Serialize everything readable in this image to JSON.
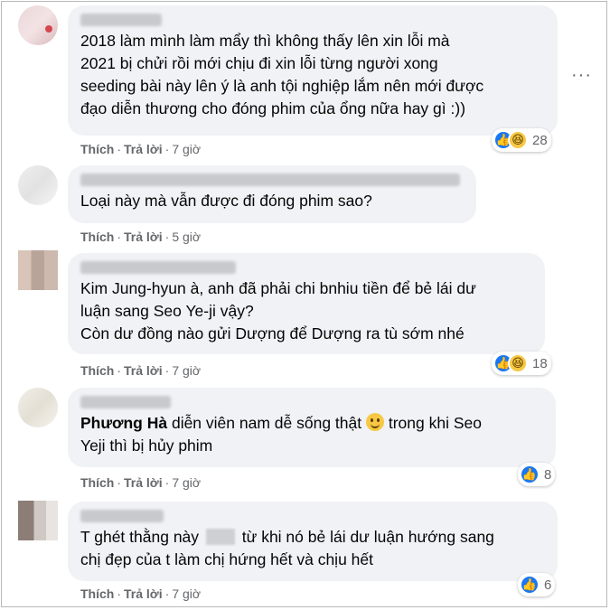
{
  "actions": {
    "like": "Thích",
    "reply": "Trả lời"
  },
  "menu_icon": "more-horizontal-icon",
  "comments": [
    {
      "text": "2018 làm mình làm mẩy thì không thấy lên xin lỗi mà\n2021 bị chửi rồi mới chịu đi xin lỗi từng người xong\nseeding bài này lên ý là anh tội nghiệp lắm nên mới được\nđạo diễn thương cho đóng phim của ổng nữa hay gì :))",
      "time": "7 giờ",
      "reactions": [
        "like",
        "haha"
      ],
      "reaction_count": "28"
    },
    {
      "text": "Loại này mà vẫn được đi đóng phim sao?",
      "time": "5 giờ"
    },
    {
      "text": "Kim Jung-hyun à, anh đã phải chi bnhiu tiền để bẻ lái dư\nluận sang Seo Ye-ji vậy?\nCòn dư đồng nào gửi Dượng để Dượng ra tù sớm nhé",
      "time": "7 giờ",
      "reactions": [
        "like",
        "haha"
      ],
      "reaction_count": "18"
    },
    {
      "mention": "Phương Hà",
      "text_a": " diễn viên nam dễ sống thật ",
      "text_b": " trong khi Seo\nYeji thì bị hủy phim",
      "emoji": "smiling-face-emoji",
      "time": "7 giờ",
      "reactions": [
        "like"
      ],
      "reaction_count": "8"
    },
    {
      "text_a": "T ghét thằng này ",
      "text_b": " từ khi nó bẻ lái dư luận hướng sang\nchị đẹp của t làm chị hứng hết và chịu hết",
      "time": "7 giờ",
      "reactions": [
        "like"
      ],
      "reaction_count": "6"
    }
  ]
}
